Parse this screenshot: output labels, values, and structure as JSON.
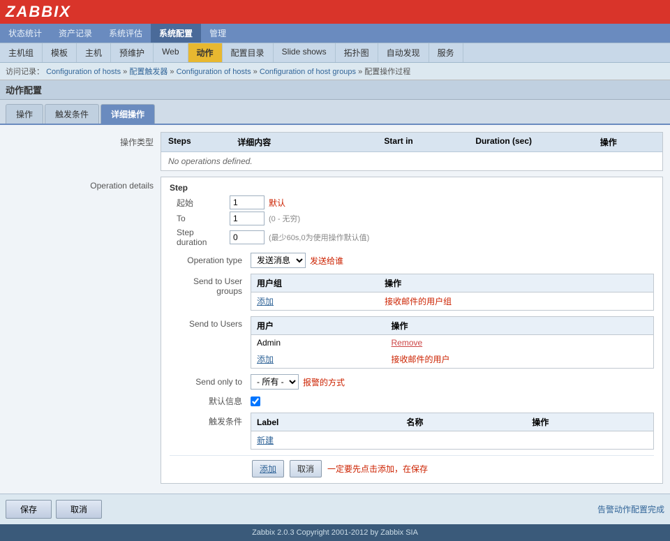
{
  "header": {
    "logo": "ZABBIX"
  },
  "top_nav": {
    "items": [
      {
        "label": "状态统计",
        "active": false
      },
      {
        "label": "资产记录",
        "active": false
      },
      {
        "label": "系统评估",
        "active": false
      },
      {
        "label": "系统配置",
        "active": true
      },
      {
        "label": "管理",
        "active": false
      }
    ]
  },
  "second_nav": {
    "items": [
      {
        "label": "主机组",
        "active": false
      },
      {
        "label": "模板",
        "active": false
      },
      {
        "label": "主机",
        "active": false
      },
      {
        "label": "预维护",
        "active": false
      },
      {
        "label": "Web",
        "active": false
      },
      {
        "label": "动作",
        "active": true
      },
      {
        "label": "配置目录",
        "active": false
      },
      {
        "label": "Slide shows",
        "active": false
      },
      {
        "label": "拓扑图",
        "active": false
      },
      {
        "label": "自动发现",
        "active": false
      },
      {
        "label": "服务",
        "active": false
      }
    ]
  },
  "breadcrumb": {
    "prefix": "访问记录：",
    "items": [
      {
        "label": "Configuration of hosts"
      },
      {
        "label": "配置触发器"
      },
      {
        "label": "Configuration of hosts"
      },
      {
        "label": "Configuration of host groups"
      },
      {
        "label": "配置操作过程"
      }
    ],
    "separator": " » "
  },
  "page_title": "动作配置",
  "tabs": [
    {
      "label": "操作",
      "active": false
    },
    {
      "label": "触发条件",
      "active": false
    },
    {
      "label": "详细操作",
      "active": true
    }
  ],
  "operations_table": {
    "label": "操作类型",
    "columns": [
      {
        "label": "Steps"
      },
      {
        "label": "详细内容"
      },
      {
        "label": "Start in"
      },
      {
        "label": "Duration (sec)"
      },
      {
        "label": "操作"
      }
    ],
    "empty_message": "No operations defined."
  },
  "operation_details": {
    "section_label": "Operation details",
    "step": {
      "label": "Step",
      "start_label": "起始",
      "start_value": "1",
      "start_hint": "默认",
      "to_label": "To",
      "to_value": "1",
      "to_hint": "(0 - 无穷)",
      "duration_label": "Step duration",
      "duration_value": "0",
      "duration_hint": "(最少60s,0为使用操作默认值)"
    },
    "op_type": {
      "label": "Operation type",
      "value": "发送消息",
      "hint": "发送给谁"
    },
    "send_user_groups": {
      "label": "Send to User groups",
      "col1": "用户组",
      "col2": "操作",
      "add_label": "添加",
      "hint": "接收邮件的用户组"
    },
    "send_users": {
      "label": "Send to Users",
      "col1": "用户",
      "col2": "操作",
      "rows": [
        {
          "user": "Admin",
          "action": "Remove"
        }
      ],
      "add_label": "添加",
      "hint": "接收邮件的用户"
    },
    "send_only_to": {
      "label": "Send only to",
      "value": "- 所有 -",
      "hint": "报警的方式"
    },
    "default_msg": {
      "label": "默认信息",
      "checked": true
    },
    "conditions": {
      "label": "触发条件",
      "col1": "Label",
      "col2": "名称",
      "col3": "操作",
      "new_label": "新建"
    }
  },
  "add_cancel": {
    "add_label": "添加",
    "cancel_label": "取消",
    "hint": "一定要先点击添加，在保存"
  },
  "bottom_buttons": {
    "save_label": "保存",
    "cancel_label": "取消",
    "success_hint": "告警动作配置完成"
  },
  "footer": {
    "text": "Zabbix 2.0.3 Copyright 2001-2012 by Zabbix SIA"
  }
}
